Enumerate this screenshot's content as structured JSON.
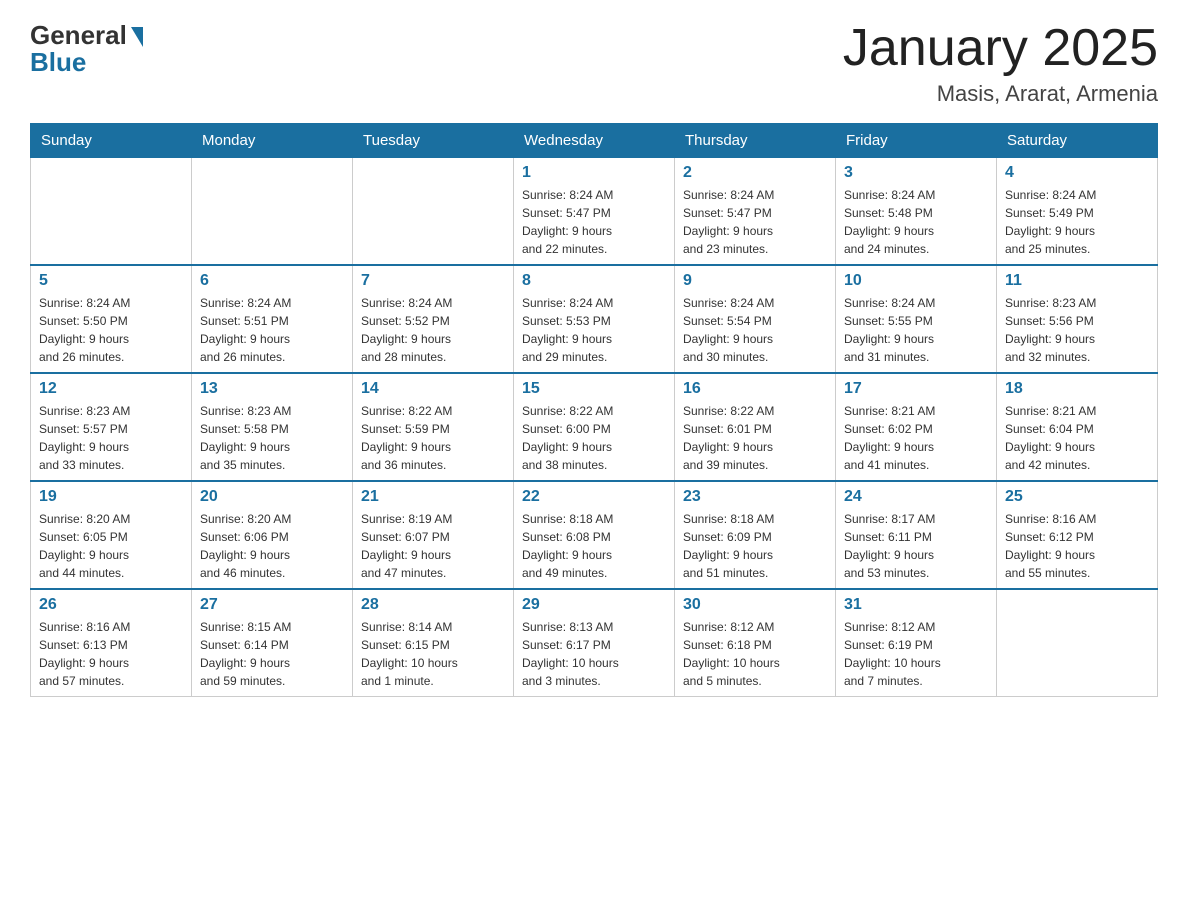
{
  "logo": {
    "general": "General",
    "blue": "Blue"
  },
  "title": "January 2025",
  "subtitle": "Masis, Ararat, Armenia",
  "days_of_week": [
    "Sunday",
    "Monday",
    "Tuesday",
    "Wednesday",
    "Thursday",
    "Friday",
    "Saturday"
  ],
  "weeks": [
    [
      {
        "day": "",
        "info": ""
      },
      {
        "day": "",
        "info": ""
      },
      {
        "day": "",
        "info": ""
      },
      {
        "day": "1",
        "info": "Sunrise: 8:24 AM\nSunset: 5:47 PM\nDaylight: 9 hours\nand 22 minutes."
      },
      {
        "day": "2",
        "info": "Sunrise: 8:24 AM\nSunset: 5:47 PM\nDaylight: 9 hours\nand 23 minutes."
      },
      {
        "day": "3",
        "info": "Sunrise: 8:24 AM\nSunset: 5:48 PM\nDaylight: 9 hours\nand 24 minutes."
      },
      {
        "day": "4",
        "info": "Sunrise: 8:24 AM\nSunset: 5:49 PM\nDaylight: 9 hours\nand 25 minutes."
      }
    ],
    [
      {
        "day": "5",
        "info": "Sunrise: 8:24 AM\nSunset: 5:50 PM\nDaylight: 9 hours\nand 26 minutes."
      },
      {
        "day": "6",
        "info": "Sunrise: 8:24 AM\nSunset: 5:51 PM\nDaylight: 9 hours\nand 26 minutes."
      },
      {
        "day": "7",
        "info": "Sunrise: 8:24 AM\nSunset: 5:52 PM\nDaylight: 9 hours\nand 28 minutes."
      },
      {
        "day": "8",
        "info": "Sunrise: 8:24 AM\nSunset: 5:53 PM\nDaylight: 9 hours\nand 29 minutes."
      },
      {
        "day": "9",
        "info": "Sunrise: 8:24 AM\nSunset: 5:54 PM\nDaylight: 9 hours\nand 30 minutes."
      },
      {
        "day": "10",
        "info": "Sunrise: 8:24 AM\nSunset: 5:55 PM\nDaylight: 9 hours\nand 31 minutes."
      },
      {
        "day": "11",
        "info": "Sunrise: 8:23 AM\nSunset: 5:56 PM\nDaylight: 9 hours\nand 32 minutes."
      }
    ],
    [
      {
        "day": "12",
        "info": "Sunrise: 8:23 AM\nSunset: 5:57 PM\nDaylight: 9 hours\nand 33 minutes."
      },
      {
        "day": "13",
        "info": "Sunrise: 8:23 AM\nSunset: 5:58 PM\nDaylight: 9 hours\nand 35 minutes."
      },
      {
        "day": "14",
        "info": "Sunrise: 8:22 AM\nSunset: 5:59 PM\nDaylight: 9 hours\nand 36 minutes."
      },
      {
        "day": "15",
        "info": "Sunrise: 8:22 AM\nSunset: 6:00 PM\nDaylight: 9 hours\nand 38 minutes."
      },
      {
        "day": "16",
        "info": "Sunrise: 8:22 AM\nSunset: 6:01 PM\nDaylight: 9 hours\nand 39 minutes."
      },
      {
        "day": "17",
        "info": "Sunrise: 8:21 AM\nSunset: 6:02 PM\nDaylight: 9 hours\nand 41 minutes."
      },
      {
        "day": "18",
        "info": "Sunrise: 8:21 AM\nSunset: 6:04 PM\nDaylight: 9 hours\nand 42 minutes."
      }
    ],
    [
      {
        "day": "19",
        "info": "Sunrise: 8:20 AM\nSunset: 6:05 PM\nDaylight: 9 hours\nand 44 minutes."
      },
      {
        "day": "20",
        "info": "Sunrise: 8:20 AM\nSunset: 6:06 PM\nDaylight: 9 hours\nand 46 minutes."
      },
      {
        "day": "21",
        "info": "Sunrise: 8:19 AM\nSunset: 6:07 PM\nDaylight: 9 hours\nand 47 minutes."
      },
      {
        "day": "22",
        "info": "Sunrise: 8:18 AM\nSunset: 6:08 PM\nDaylight: 9 hours\nand 49 minutes."
      },
      {
        "day": "23",
        "info": "Sunrise: 8:18 AM\nSunset: 6:09 PM\nDaylight: 9 hours\nand 51 minutes."
      },
      {
        "day": "24",
        "info": "Sunrise: 8:17 AM\nSunset: 6:11 PM\nDaylight: 9 hours\nand 53 minutes."
      },
      {
        "day": "25",
        "info": "Sunrise: 8:16 AM\nSunset: 6:12 PM\nDaylight: 9 hours\nand 55 minutes."
      }
    ],
    [
      {
        "day": "26",
        "info": "Sunrise: 8:16 AM\nSunset: 6:13 PM\nDaylight: 9 hours\nand 57 minutes."
      },
      {
        "day": "27",
        "info": "Sunrise: 8:15 AM\nSunset: 6:14 PM\nDaylight: 9 hours\nand 59 minutes."
      },
      {
        "day": "28",
        "info": "Sunrise: 8:14 AM\nSunset: 6:15 PM\nDaylight: 10 hours\nand 1 minute."
      },
      {
        "day": "29",
        "info": "Sunrise: 8:13 AM\nSunset: 6:17 PM\nDaylight: 10 hours\nand 3 minutes."
      },
      {
        "day": "30",
        "info": "Sunrise: 8:12 AM\nSunset: 6:18 PM\nDaylight: 10 hours\nand 5 minutes."
      },
      {
        "day": "31",
        "info": "Sunrise: 8:12 AM\nSunset: 6:19 PM\nDaylight: 10 hours\nand 7 minutes."
      },
      {
        "day": "",
        "info": ""
      }
    ]
  ]
}
